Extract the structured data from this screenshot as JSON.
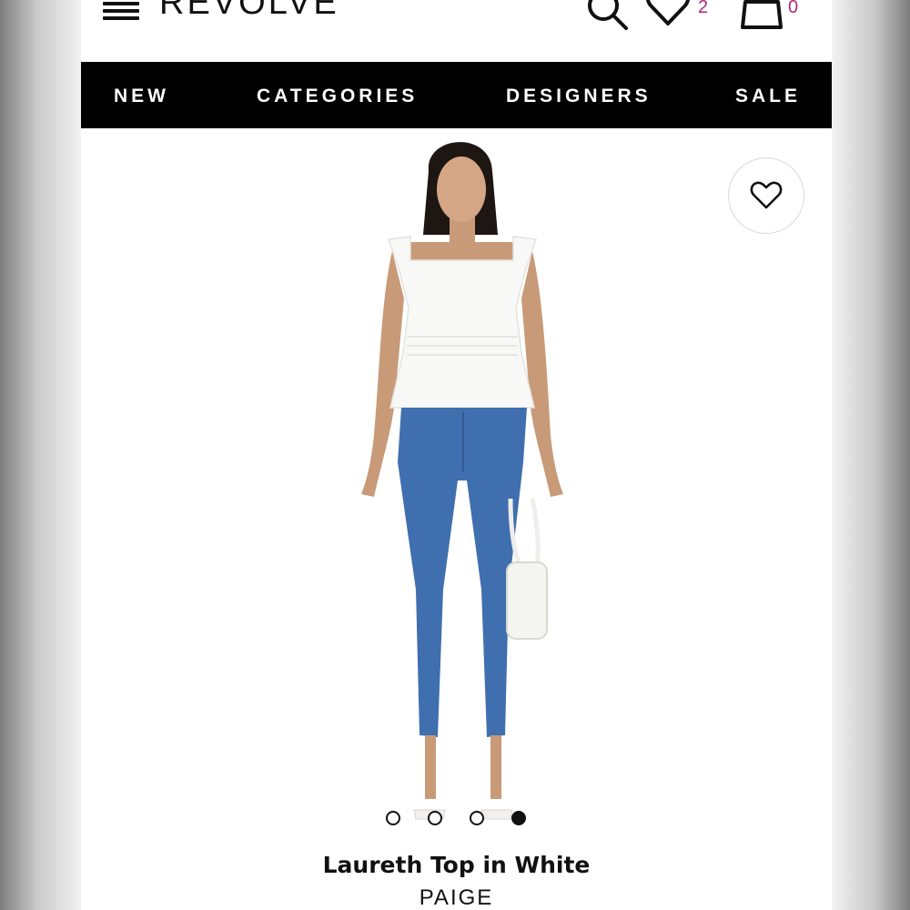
{
  "header": {
    "logo": "REVOLVE",
    "wishlist_count": "2",
    "cart_count": "0"
  },
  "nav": {
    "items": [
      "NEW",
      "CATEGORIES",
      "DESIGNERS",
      "SALE"
    ]
  },
  "product": {
    "title": "Laureth Top in White",
    "brand": "PAIGE",
    "gallery": {
      "image_count": 4,
      "active_index": 3
    }
  },
  "colors": {
    "nav_background": "#000000",
    "badge": "#b1287a",
    "denim": "#3f6fae"
  },
  "icons": [
    "menu-icon",
    "search-icon",
    "heart-icon",
    "bag-icon"
  ]
}
